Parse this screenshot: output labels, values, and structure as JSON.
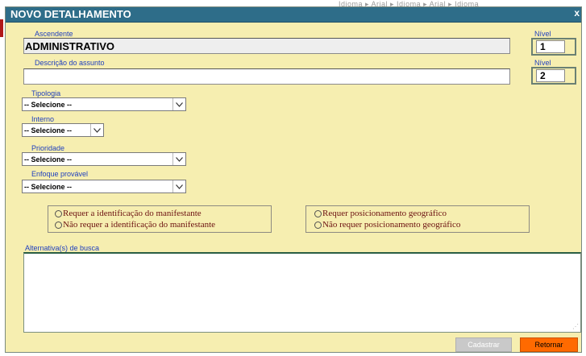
{
  "background_text": "Idioma  ▸  Arial  ▸  Idioma  ▸  Arial  ▸  Idioma",
  "window": {
    "title": "NOVO DETALHAMENTO",
    "close_symbol": "x"
  },
  "ascendente": {
    "label": "Ascendente",
    "value": "ADMINISTRATIVO"
  },
  "nivel1": {
    "label": "Nível",
    "value": "1"
  },
  "descricao": {
    "label": "Descrição do assunto",
    "value": ""
  },
  "nivel2": {
    "label": "Nível",
    "value": "2"
  },
  "tipologia": {
    "label": "Tipologia",
    "selected": "-- Selecione --"
  },
  "interno": {
    "label": "Interno",
    "selected": "-- Selecione --"
  },
  "prioridade": {
    "label": "Prioridade",
    "selected": "-- Selecione --"
  },
  "enfoque": {
    "label": "Enfoque provável",
    "selected": "-- Selecione --"
  },
  "identificacao": {
    "option1": "Requer a identificação do manifestante",
    "option2": "Não requer a identificação do manifestante"
  },
  "geografico": {
    "option1": "Requer posicionamento geográfico",
    "option2": "Não requer posicionamento geográfico"
  },
  "alternativas": {
    "label": "Alternativa(s) de busca",
    "value": ""
  },
  "buttons": {
    "cadastrar": "Cadastrar",
    "retornar": "Retornar"
  },
  "colors": {
    "titlebar": "#2e6d89",
    "panel": "#f6eeb0",
    "label": "#1f3fbf",
    "retornar": "#ff6a00"
  }
}
